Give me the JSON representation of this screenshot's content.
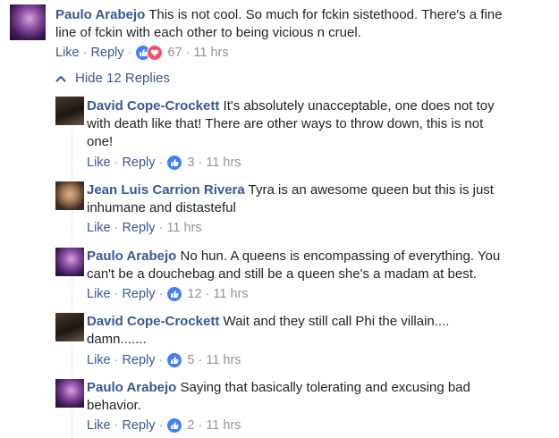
{
  "thread": {
    "hide_replies_label": "Hide 12 Replies"
  },
  "actions": {
    "like_label": "Like",
    "reply_label": "Reply",
    "separator": "·"
  },
  "colors": {
    "link": "#385898",
    "meta": "#90949c",
    "like_reaction": "#4080ff",
    "love_reaction": "#f25268"
  },
  "main_comment": {
    "author": "Paulo Arabejo",
    "text_line1": "This is not cool. So much for fckin sistethood. There's a fine",
    "text_line2": "line of fckin with each other to being vicious n cruel.",
    "reactions": [
      "like-icon",
      "love-icon"
    ],
    "reaction_count": "67",
    "time": "11 hrs"
  },
  "replies": [
    {
      "author": "David Cope-Crockett",
      "text_line1": "It's absolutely unacceptable, one does not toy",
      "text_line2": "with death like that! There are other ways to throw down, this is not",
      "text_line3": "one!",
      "reaction_count": "3",
      "time": "11 hrs"
    },
    {
      "author": "Jean Luis Carrion Rivera",
      "text_line1": "Tyra is an awesome queen but this is just",
      "text_line2": "inhumane and distasteful",
      "reaction_count": "",
      "time": "11 hrs"
    },
    {
      "author": "Paulo Arabejo",
      "text_line1": "No hun. A queens is encompassing of everything. You",
      "text_line2": "can't be a douchebag and still be a queen she's a madam at best.",
      "reaction_count": "12",
      "time": "11 hrs"
    },
    {
      "author": "David Cope-Crockett",
      "text_line1": "Wait and they still call Phi the villain....",
      "text_line2": "damn.......",
      "reaction_count": "5",
      "time": "11 hrs"
    },
    {
      "author": "Paulo Arabejo",
      "text_line1": "Saying that basically tolerating and excusing bad",
      "text_line2": "behavior.",
      "reaction_count": "2",
      "time": "11 hrs"
    }
  ]
}
